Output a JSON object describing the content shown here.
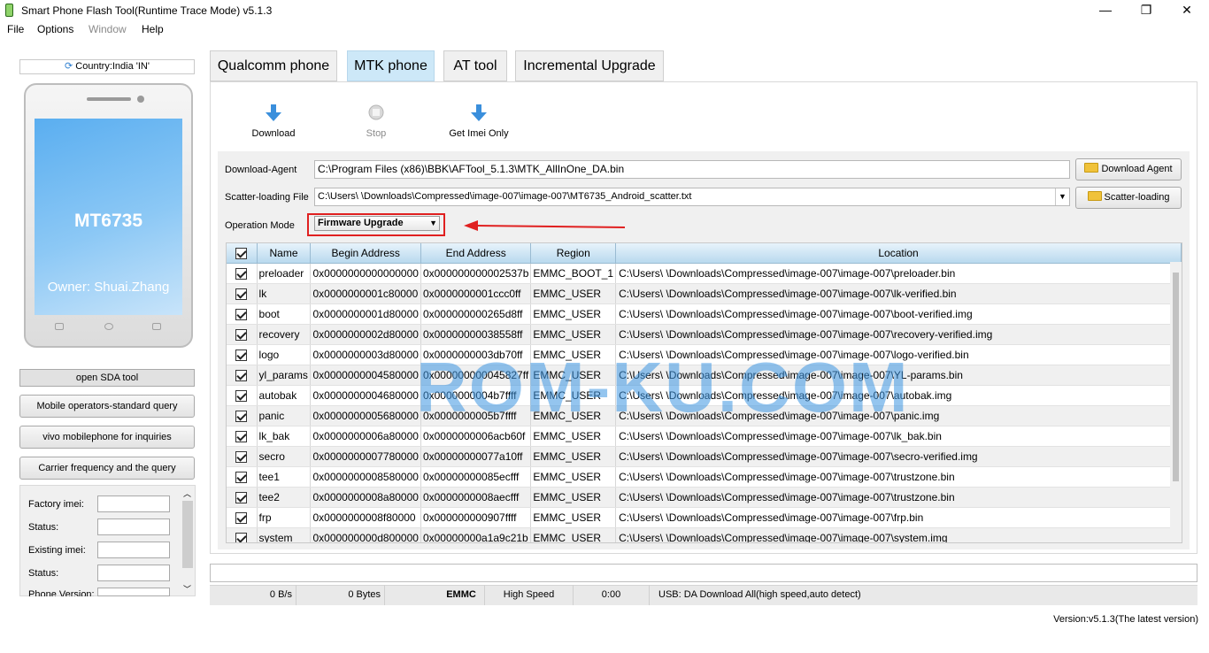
{
  "window": {
    "title": "Smart Phone Flash Tool(Runtime Trace Mode)  v5.1.3",
    "minimize": "—",
    "maximize": "❐",
    "close": "✕"
  },
  "menu": [
    "File",
    "Options",
    "Window",
    "Help"
  ],
  "left": {
    "country": "Country:India 'IN'",
    "phone_model": "MT6735",
    "phone_owner": "Owner: Shuai.Zhang",
    "buttons": [
      "open SDA tool",
      "Mobile operators-standard query",
      "vivo mobilephone for inquiries",
      "Carrier frequency and the query"
    ],
    "imei_labels": [
      "Factory imei:",
      "Status:",
      "Existing imei:",
      "Status:",
      "Phone Version:"
    ]
  },
  "tabs": [
    "Qualcomm phone",
    "MTK phone",
    "AT tool",
    "Incremental Upgrade"
  ],
  "active_tab": "MTK phone",
  "toolbar": {
    "download": "Download",
    "stop": "Stop",
    "get_imei": "Get Imei Only"
  },
  "fields": {
    "download_agent_label": "Download-Agent",
    "download_agent_value": "C:\\Program Files (x86)\\BBK\\AFTool_5.1.3\\MTK_AllInOne_DA.bin",
    "scatter_label": "Scatter-loading File",
    "scatter_value": "C:\\Users\\              \\Downloads\\Compressed\\image-007\\image-007\\MT6735_Android_scatter.txt",
    "opmode_label": "Operation Mode",
    "opmode_value": "Firmware Upgrade",
    "download_agent_btn": "Download Agent",
    "scatter_btn": "Scatter-loading"
  },
  "table": {
    "columns": [
      "Name",
      "Begin Address",
      "End Address",
      "Region",
      "Location"
    ],
    "rows": [
      [
        "preloader",
        "0x0000000000000000",
        "0x000000000002537b",
        "EMMC_BOOT_1",
        "C:\\Users\\              \\Downloads\\Compressed\\image-007\\image-007\\preloader.bin"
      ],
      [
        "lk",
        "0x0000000001c80000",
        "0x0000000001ccc0ff",
        "EMMC_USER",
        "C:\\Users\\              \\Downloads\\Compressed\\image-007\\image-007\\lk-verified.bin"
      ],
      [
        "boot",
        "0x0000000001d80000",
        "0x000000000265d8ff",
        "EMMC_USER",
        "C:\\Users\\              \\Downloads\\Compressed\\image-007\\image-007\\boot-verified.img"
      ],
      [
        "recovery",
        "0x0000000002d80000",
        "0x00000000038558ff",
        "EMMC_USER",
        "C:\\Users\\              \\Downloads\\Compressed\\image-007\\image-007\\recovery-verified.img"
      ],
      [
        "logo",
        "0x0000000003d80000",
        "0x0000000003db70ff",
        "EMMC_USER",
        "C:\\Users\\              \\Downloads\\Compressed\\image-007\\image-007\\logo-verified.bin"
      ],
      [
        "yl_params",
        "0x0000000004580000",
        "0x000000000045827ff",
        "EMMC_USER",
        "C:\\Users\\              \\Downloads\\Compressed\\image-007\\image-007\\YL-params.bin"
      ],
      [
        "autobak",
        "0x0000000004680000",
        "0x0000000004b7ffff",
        "EMMC_USER",
        "C:\\Users\\              \\Downloads\\Compressed\\image-007\\image-007\\autobak.img"
      ],
      [
        "panic",
        "0x0000000005680000",
        "0x0000000005b7ffff",
        "EMMC_USER",
        "C:\\Users\\              \\Downloads\\Compressed\\image-007\\image-007\\panic.img"
      ],
      [
        "lk_bak",
        "0x0000000006a80000",
        "0x0000000006acb60f",
        "EMMC_USER",
        "C:\\Users\\              \\Downloads\\Compressed\\image-007\\image-007\\lk_bak.bin"
      ],
      [
        "secro",
        "0x0000000007780000",
        "0x00000000077a10ff",
        "EMMC_USER",
        "C:\\Users\\              \\Downloads\\Compressed\\image-007\\image-007\\secro-verified.img"
      ],
      [
        "tee1",
        "0x0000000008580000",
        "0x00000000085ecfff",
        "EMMC_USER",
        "C:\\Users\\              \\Downloads\\Compressed\\image-007\\image-007\\trustzone.bin"
      ],
      [
        "tee2",
        "0x0000000008a80000",
        "0x0000000008aecfff",
        "EMMC_USER",
        "C:\\Users\\              \\Downloads\\Compressed\\image-007\\image-007\\trustzone.bin"
      ],
      [
        "frp",
        "0x0000000008f80000",
        "0x000000000907ffff",
        "EMMC_USER",
        "C:\\Users\\              \\Downloads\\Compressed\\image-007\\image-007\\frp.bin"
      ],
      [
        "system",
        "0x000000000d800000",
        "0x00000000a1a9c21b",
        "EMMC_USER",
        "C:\\Users\\              \\Downloads\\Compressed\\image-007\\image-007\\system.img"
      ]
    ]
  },
  "watermark": "ROM-KU.COM",
  "status": {
    "speed": "0 B/s",
    "bytes": "0 Bytes",
    "storage": "EMMC",
    "mode": "High Speed",
    "time": "0:00",
    "usb": "USB: DA Download All(high speed,auto detect)"
  },
  "version": "Version:v5.1.3(The latest version)",
  "colors": {
    "active_tab": "#cde8f8",
    "highlight": "#e02020",
    "phone_screen": "#5aaef0",
    "watermark": "#3c96e1"
  }
}
